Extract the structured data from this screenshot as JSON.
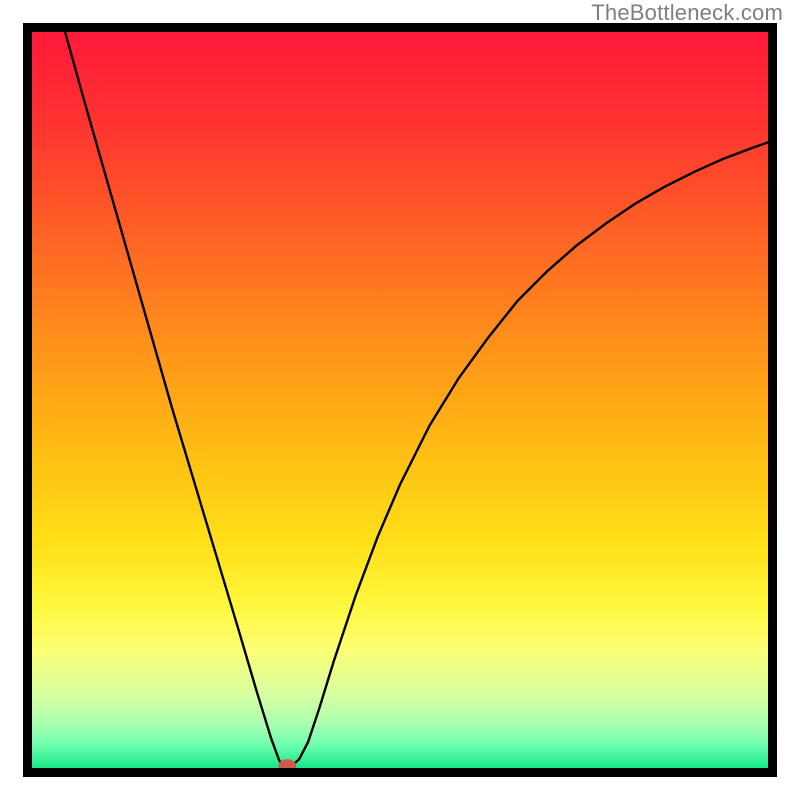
{
  "watermark": "TheBottleneck.com",
  "chart_data": {
    "type": "line",
    "title": "",
    "xlabel": "",
    "ylabel": "",
    "xlim": [
      0,
      100
    ],
    "ylim": [
      0,
      100
    ],
    "grid": false,
    "legend": false,
    "background": {
      "mode": "vertical-gradient",
      "stops": [
        {
          "offset": 0.0,
          "color": "#ff1a3a"
        },
        {
          "offset": 0.1,
          "color": "#ff2d33"
        },
        {
          "offset": 0.2,
          "color": "#ff4a2a"
        },
        {
          "offset": 0.3,
          "color": "#ff6a23"
        },
        {
          "offset": 0.4,
          "color": "#ff8a1c"
        },
        {
          "offset": 0.5,
          "color": "#ffa816"
        },
        {
          "offset": 0.6,
          "color": "#ffc614"
        },
        {
          "offset": 0.7,
          "color": "#ffe119"
        },
        {
          "offset": 0.78,
          "color": "#fff83e"
        },
        {
          "offset": 0.84,
          "color": "#fbff75"
        },
        {
          "offset": 0.9,
          "color": "#d8ffa0"
        },
        {
          "offset": 0.94,
          "color": "#aaffb1"
        },
        {
          "offset": 0.97,
          "color": "#6bfdb0"
        },
        {
          "offset": 1.0,
          "color": "#18e887"
        }
      ]
    },
    "series": [
      {
        "name": "curve",
        "stroke": "#000000",
        "stroke_width": 2.4,
        "points": [
          {
            "x": 4.5,
            "y": 100.0
          },
          {
            "x": 7.0,
            "y": 91.0
          },
          {
            "x": 10.0,
            "y": 80.5
          },
          {
            "x": 13.0,
            "y": 70.0
          },
          {
            "x": 16.0,
            "y": 59.5
          },
          {
            "x": 19.0,
            "y": 49.0
          },
          {
            "x": 22.0,
            "y": 39.0
          },
          {
            "x": 25.0,
            "y": 29.0
          },
          {
            "x": 28.0,
            "y": 19.0
          },
          {
            "x": 30.5,
            "y": 10.5
          },
          {
            "x": 32.5,
            "y": 4.0
          },
          {
            "x": 33.6,
            "y": 1.0
          },
          {
            "x": 34.3,
            "y": 0.2
          },
          {
            "x": 35.2,
            "y": 0.2
          },
          {
            "x": 36.3,
            "y": 1.2
          },
          {
            "x": 37.5,
            "y": 3.5
          },
          {
            "x": 39.0,
            "y": 8.0
          },
          {
            "x": 41.0,
            "y": 14.5
          },
          {
            "x": 44.0,
            "y": 23.5
          },
          {
            "x": 47.0,
            "y": 31.5
          },
          {
            "x": 50.0,
            "y": 38.5
          },
          {
            "x": 54.0,
            "y": 46.5
          },
          {
            "x": 58.0,
            "y": 53.0
          },
          {
            "x": 62.0,
            "y": 58.5
          },
          {
            "x": 66.0,
            "y": 63.5
          },
          {
            "x": 70.0,
            "y": 67.5
          },
          {
            "x": 74.0,
            "y": 71.0
          },
          {
            "x": 78.0,
            "y": 74.0
          },
          {
            "x": 82.0,
            "y": 76.7
          },
          {
            "x": 86.0,
            "y": 79.0
          },
          {
            "x": 90.0,
            "y": 81.0
          },
          {
            "x": 94.0,
            "y": 82.8
          },
          {
            "x": 98.0,
            "y": 84.3
          },
          {
            "x": 100.0,
            "y": 85.0
          }
        ]
      }
    ],
    "marker": {
      "x": 34.7,
      "y": 0.3,
      "rx": 1.2,
      "ry": 0.9,
      "fill": "#d05a4e"
    }
  }
}
